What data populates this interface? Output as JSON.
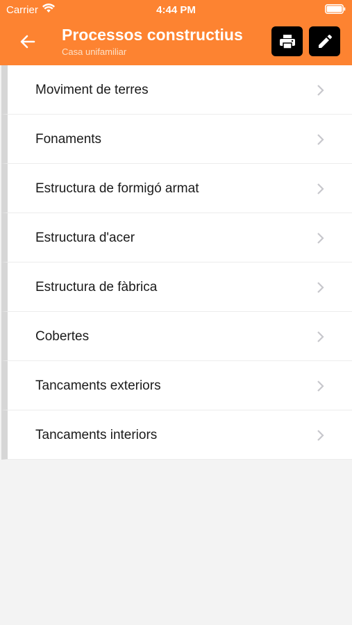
{
  "status_bar": {
    "carrier": "Carrier",
    "time": "4:44 PM"
  },
  "header": {
    "title": "Processos constructius",
    "subtitle": "Casa unifamiliar",
    "background_color": "#fd8331",
    "back_icon": "arrow-left-icon",
    "print_icon": "printer-icon",
    "edit_icon": "pencil-icon"
  },
  "list": {
    "items": [
      {
        "label": "Moviment de terres"
      },
      {
        "label": "Fonaments"
      },
      {
        "label": "Estructura de formigó armat"
      },
      {
        "label": "Estructura d'acer"
      },
      {
        "label": "Estructura de fàbrica"
      },
      {
        "label": "Cobertes"
      },
      {
        "label": "Tancaments exteriors"
      },
      {
        "label": "Tancaments interiors"
      }
    ],
    "chevron_icon": "chevron-right-icon"
  }
}
